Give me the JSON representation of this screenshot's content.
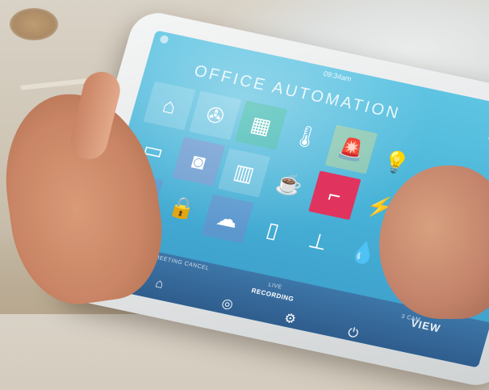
{
  "screen": {
    "clock": "09:34am",
    "title": "OFFICE AUTOMATION",
    "tiles": [
      {
        "icon": "house-icon",
        "glyph": "⌂",
        "highlight": false
      },
      {
        "icon": "fan-icon",
        "glyph": "✇",
        "highlight": false
      },
      {
        "icon": "window-grid-icon",
        "glyph": "▦",
        "highlight": false
      },
      {
        "icon": "tv-icon",
        "glyph": "▭",
        "highlight": false
      },
      {
        "icon": "security-camera-icon",
        "glyph": "◙",
        "highlight": false
      },
      {
        "icon": "blinds-icon",
        "glyph": "▥",
        "highlight": false
      },
      {
        "icon": "thermometer-icon",
        "glyph": "🌡",
        "highlight": false
      },
      {
        "icon": "alarm-light-icon",
        "glyph": "🚨",
        "highlight": false
      },
      {
        "icon": "lightbulb-icon",
        "glyph": "💡",
        "highlight": false
      },
      {
        "icon": "intercom-icon",
        "glyph": "☎",
        "highlight": false
      },
      {
        "icon": "padlock-icon",
        "glyph": "🔒",
        "highlight": false
      },
      {
        "icon": "cloud-network-icon",
        "glyph": "☁",
        "highlight": false
      },
      {
        "icon": "coffee-cup-icon",
        "glyph": "☕",
        "highlight": false
      },
      {
        "icon": "door-handle-icon",
        "glyph": "⌐",
        "highlight": true
      },
      {
        "icon": "power-bolt-icon",
        "glyph": "⚡",
        "highlight": false
      },
      {
        "icon": "fridge-icon",
        "glyph": "▯",
        "highlight": false
      },
      {
        "icon": "router-icon",
        "glyph": "⊥",
        "highlight": false
      },
      {
        "icon": "water-drop-icon",
        "glyph": "💧",
        "highlight": false
      }
    ],
    "bottom_nav": {
      "left_label": "OFFICE MEETING CANCEL",
      "center_top": "LIVE",
      "center_label": "RECORDING",
      "right_top": "3 CAM",
      "right_label": "VIEW"
    }
  }
}
